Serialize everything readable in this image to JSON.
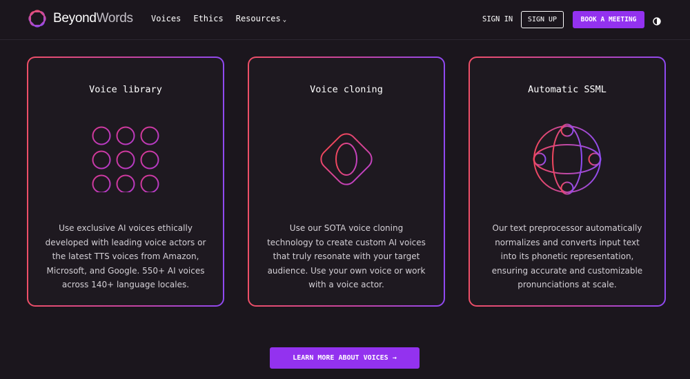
{
  "brand": {
    "name_part1": "Beyond",
    "name_part2": "Words"
  },
  "nav": {
    "items": [
      {
        "label": "Voices"
      },
      {
        "label": "Ethics"
      },
      {
        "label": "Resources",
        "chevron": "⌄"
      }
    ]
  },
  "header_actions": {
    "sign_in": "SIGN IN",
    "sign_up": "SIGN UP",
    "book_meeting": "BOOK A MEETING",
    "theme_toggle_icon": "contrast-icon"
  },
  "cards": [
    {
      "title": "Voice library",
      "icon": "dot-grid-icon",
      "description": "Use exclusive AI voices ethically developed with leading voice actors or the latest TTS voices from Amazon, Microsoft, and Google. 550+ AI voices across 140+ language locales."
    },
    {
      "title": "Voice cloning",
      "icon": "diamond-voice-icon",
      "description": "Use our SOTA voice cloning technology to create custom AI voices that truly resonate with your target audience. Use your own voice or work with a voice actor."
    },
    {
      "title": "Automatic SSML",
      "icon": "globe-icon",
      "description": "Our text preprocessor automatically normalizes and converts input text into its phonetic representation, ensuring accurate and customizable pronunciations at scale."
    }
  ],
  "cta": {
    "label": "LEARN MORE ABOUT VOICES",
    "arrow": "→"
  },
  "colors": {
    "background": "#1b161d",
    "accent": "#9332ef",
    "gradient_start": "#ee4f67",
    "gradient_end": "#8f49f2"
  }
}
